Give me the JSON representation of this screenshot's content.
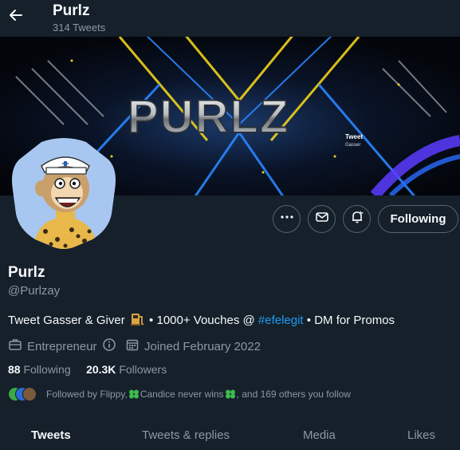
{
  "header": {
    "title": "Purlz",
    "tweet_count": "314 Tweets"
  },
  "banner": {
    "logo_text": "PURLZ",
    "tagline_1": "Tweet",
    "tagline_2": "Gasser"
  },
  "profile": {
    "name": "Purlz",
    "handle": "@Purlzay",
    "bio_part1": "Tweet Gasser & Giver",
    "bio_part2": " • 1000+ Vouches @ ",
    "bio_link": "#efelegit",
    "bio_part3": " • DM for Promos",
    "category": "Entrepreneur",
    "joined": "Joined February 2022",
    "following_count": "88",
    "following_label": "Following",
    "followers_count": "20.3K",
    "followers_label": "Followers",
    "followed_by": "Followed by Flippy, ",
    "followed_by_mid": " Candice never wins ",
    "followed_by_end": ", and 169 others you follow"
  },
  "actions": {
    "more_icon": "more-icon",
    "message_icon": "message-icon",
    "notify_icon": "notify-bell-icon",
    "following_label": "Following"
  },
  "tabs": [
    {
      "label": "Tweets",
      "active": true
    },
    {
      "label": "Tweets & replies",
      "active": false
    },
    {
      "label": "Media",
      "active": false
    },
    {
      "label": "Likes",
      "active": false
    }
  ],
  "colors": {
    "background": "#15202b",
    "accent": "#1d9bf0",
    "muted": "#8b98a5",
    "text": "#f7f9f9",
    "border": "#536471"
  }
}
